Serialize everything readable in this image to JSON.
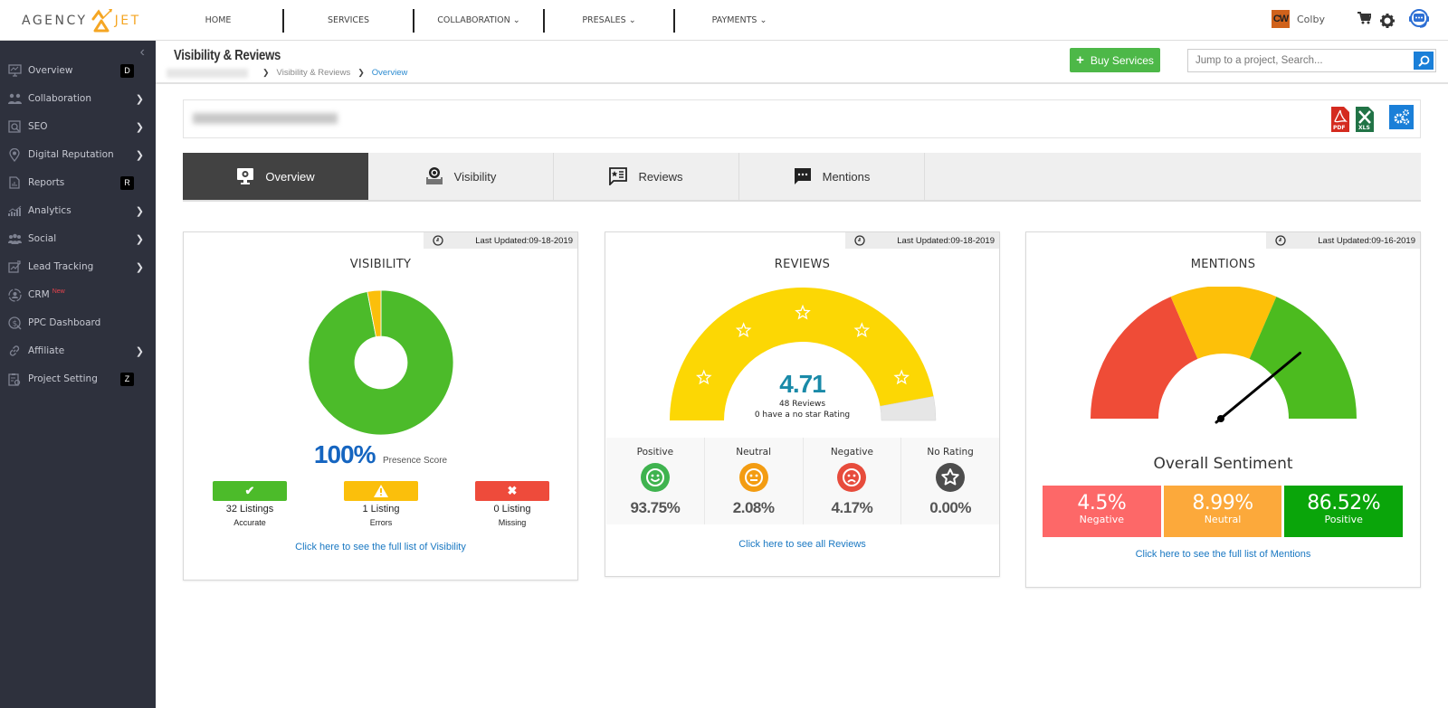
{
  "brand": {
    "logo_left": "AGENCY",
    "logo_right": "JET",
    "accent": "#f5a623"
  },
  "topnav": {
    "items": [
      {
        "label": "HOME",
        "dropdown": false
      },
      {
        "label": "SERVICES",
        "dropdown": false
      },
      {
        "label": "COLLABORATION ⌄",
        "dropdown": true
      },
      {
        "label": "PRESALES ⌄",
        "dropdown": true
      },
      {
        "label": "PAYMENTS ⌄",
        "dropdown": true
      }
    ],
    "user": {
      "initials": "CW",
      "name": "Colby"
    },
    "icons": [
      "cart-icon",
      "gear-icon",
      "support-headset-icon"
    ]
  },
  "sidebar": {
    "items": [
      {
        "label": "Overview",
        "icon": "monitor-icon",
        "shortcut": "D",
        "chevron": false
      },
      {
        "label": "Collaboration",
        "icon": "users-icon",
        "chevron": true
      },
      {
        "label": "SEO",
        "icon": "seo-search-icon",
        "chevron": true
      },
      {
        "label": "Digital Reputation",
        "icon": "location-star-icon",
        "chevron": true
      },
      {
        "label": "Reports",
        "icon": "report-icon",
        "shortcut": "R",
        "chevron": false
      },
      {
        "label": "Analytics",
        "icon": "analytics-icon",
        "chevron": true
      },
      {
        "label": "Social",
        "icon": "social-icon",
        "chevron": true
      },
      {
        "label": "Lead Tracking",
        "icon": "lead-tracking-icon",
        "chevron": true
      },
      {
        "label": "CRM",
        "icon": "crm-icon",
        "badge": "New",
        "chevron": false
      },
      {
        "label": "PPC Dashboard",
        "icon": "ppc-dollar-icon",
        "chevron": false
      },
      {
        "label": "Affiliate",
        "icon": "link-icon",
        "chevron": true
      },
      {
        "label": "Project Setting",
        "icon": "clipboard-gear-icon",
        "shortcut": "Z",
        "chevron": false
      }
    ]
  },
  "header": {
    "title": "Visibility & Reviews",
    "breadcrumb": [
      "Visibility & Reviews",
      "Overview"
    ],
    "buy_button": "Buy Services",
    "search_placeholder": "Jump to a project, Search..."
  },
  "tabs": [
    {
      "label": "Overview",
      "active": true
    },
    {
      "label": "Visibility",
      "active": false
    },
    {
      "label": "Reviews",
      "active": false
    },
    {
      "label": "Mentions",
      "active": false
    }
  ],
  "visibility": {
    "last_updated": "Last Updated:09-18-2019",
    "title": "VISIBILITY",
    "presence_score": "100%",
    "presence_label": "Presence Score",
    "stats": [
      {
        "count": "32 Listings",
        "label": "Accurate",
        "color": "#4cbb2a",
        "icon": "check-icon"
      },
      {
        "count": "1 Listing",
        "label": "Errors",
        "color": "#fbbf0b",
        "icon": "warning-icon"
      },
      {
        "count": "0 Listing",
        "label": "Missing",
        "color": "#ee4b3b",
        "icon": "x-icon"
      }
    ],
    "link": "Click here to see the full list of Visibility"
  },
  "reviews": {
    "last_updated": "Last Updated:09-18-2019",
    "title": "REVIEWS",
    "rating": "4.71",
    "rating_max": 5,
    "count_text": "48 Reviews",
    "no_star_text": "0 have a no star Rating",
    "breakdown": [
      {
        "label": "Positive",
        "value": "93.75%",
        "color": "#3fb34f",
        "icon": "smile-icon"
      },
      {
        "label": "Neutral",
        "value": "2.08%",
        "color": "#f39c12",
        "icon": "neutral-face-icon"
      },
      {
        "label": "Negative",
        "value": "4.17%",
        "color": "#e74c3c",
        "icon": "sad-face-icon"
      },
      {
        "label": "No Rating",
        "value": "0.00%",
        "color": "#4d4d4d",
        "icon": "star-icon"
      }
    ],
    "link": "Click here to see all Reviews"
  },
  "mentions": {
    "last_updated": "Last Updated:09-16-2019",
    "title": "MENTIONS",
    "sentiment_title": "Overall Sentiment",
    "needle_fraction": 0.78,
    "sentiment": [
      {
        "value": "4.5%",
        "label": "Negative",
        "color": "#fd6868"
      },
      {
        "value": "8.99%",
        "label": "Neutral",
        "color": "#fca93b"
      },
      {
        "value": "86.52%",
        "label": "Positive",
        "color": "#0aa50a"
      }
    ],
    "link": "Click here to see the full list of Mentions"
  },
  "chart_data": [
    {
      "type": "pie",
      "title": "VISIBILITY",
      "categories": [
        "Accurate",
        "Errors",
        "Missing"
      ],
      "values": [
        32,
        1,
        0
      ],
      "colors": [
        "#4cbb2a",
        "#fbbf0b",
        "#ee4b3b"
      ]
    },
    {
      "type": "gauge",
      "title": "REVIEWS",
      "value": 4.71,
      "range": [
        0,
        5
      ],
      "colors": [
        "#fcd704",
        "#e6e6e6"
      ]
    },
    {
      "type": "gauge",
      "title": "MENTIONS",
      "bands": [
        "Negative",
        "Neutral",
        "Positive"
      ],
      "band_colors": [
        "#ef4c37",
        "#fdc009",
        "#4cbb1f"
      ],
      "needle_fraction": 0.78
    }
  ]
}
